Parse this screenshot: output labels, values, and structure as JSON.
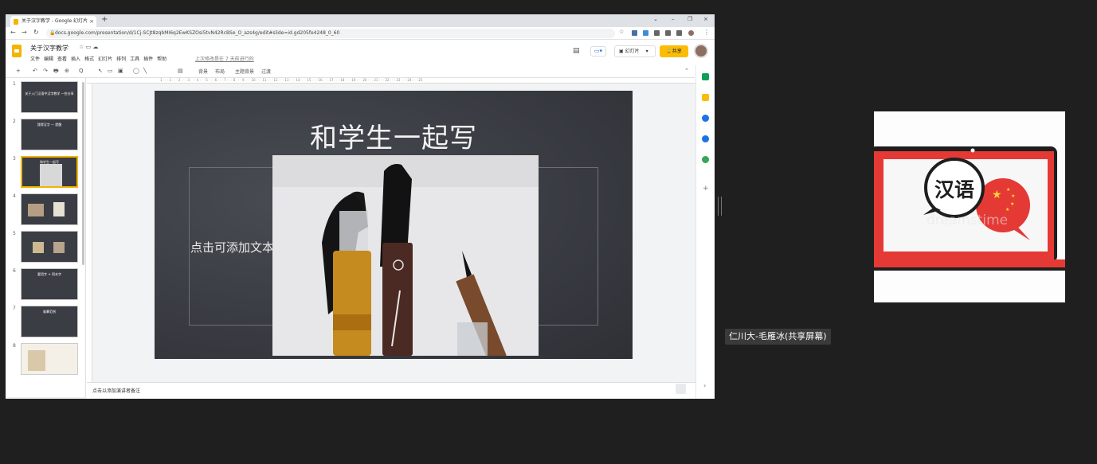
{
  "browser": {
    "tab_title": "关于汉字教学 - Google 幻灯片",
    "tab_close": "×",
    "new_tab": "+",
    "url": "docs.google.com/presentation/d/1Cj-SCJt8zqbMI6q2EwKSZOsi5tvN42RcBSe_O_azs4g/edit#slide=id.gd205fe4248_0_60",
    "win_controls": [
      "⌄",
      "–",
      "❐",
      "×"
    ]
  },
  "docs": {
    "title": "关于汉字教学",
    "menu": [
      "文件",
      "编辑",
      "查看",
      "插入",
      "格式",
      "幻灯片",
      "排列",
      "工具",
      "插件",
      "帮助"
    ],
    "last_edit": "上次修改是在 7 天前进行的",
    "slideshow_label": "幻灯片",
    "share_label": "共享"
  },
  "toolbar": {
    "items": [
      "+",
      "↶",
      "↷",
      "🖶",
      "⊕",
      "Q",
      "↖",
      "▭",
      "▣",
      "◯",
      "╲",
      "▤",
      "背景",
      "布局",
      "主题背景",
      "过渡"
    ]
  },
  "filmstrip": {
    "slides": [
      {
        "num": "1",
        "title": "关于入门汉语中汉字教学 一些分享"
      },
      {
        "num": "2",
        "title": "我得汉字 — 提醒"
      },
      {
        "num": "3",
        "title": "和学生一起写"
      },
      {
        "num": "4",
        "title": ""
      },
      {
        "num": "5",
        "title": ""
      },
      {
        "num": "6",
        "title": "要用字 + 同本字"
      },
      {
        "num": "7",
        "title": "临摹范例"
      },
      {
        "num": "8",
        "title": ""
      }
    ]
  },
  "slide": {
    "title": "和学生一起写",
    "placeholder": "点击可添加文本"
  },
  "notes": {
    "placeholder": "点击以添加演讲者备注"
  },
  "ruler_numbers": "1 · · · 1 · · · 2 · · · 3 · · · 4 · · · 5 · · · 6 · · · 7 · · · 8 · · · 9 · · · 10 · · · 11 · · · 12 · · · 13 · · · 14 · · · 15 · · · 16 · · · 17 · · · 18 · · · 19 · · · 20 · · · 21 · · · 22 · · · 23 · · · 24 · · · 25",
  "webcam": {
    "bubble_text": "汉语",
    "watermark": "dreamstime"
  },
  "participant": {
    "name": "仁川大-毛雁冰(共享屏幕)"
  },
  "colors": {
    "accent": "#fbbc04",
    "laptop_red": "#e53935",
    "slide_bg": "#3c3e45"
  }
}
